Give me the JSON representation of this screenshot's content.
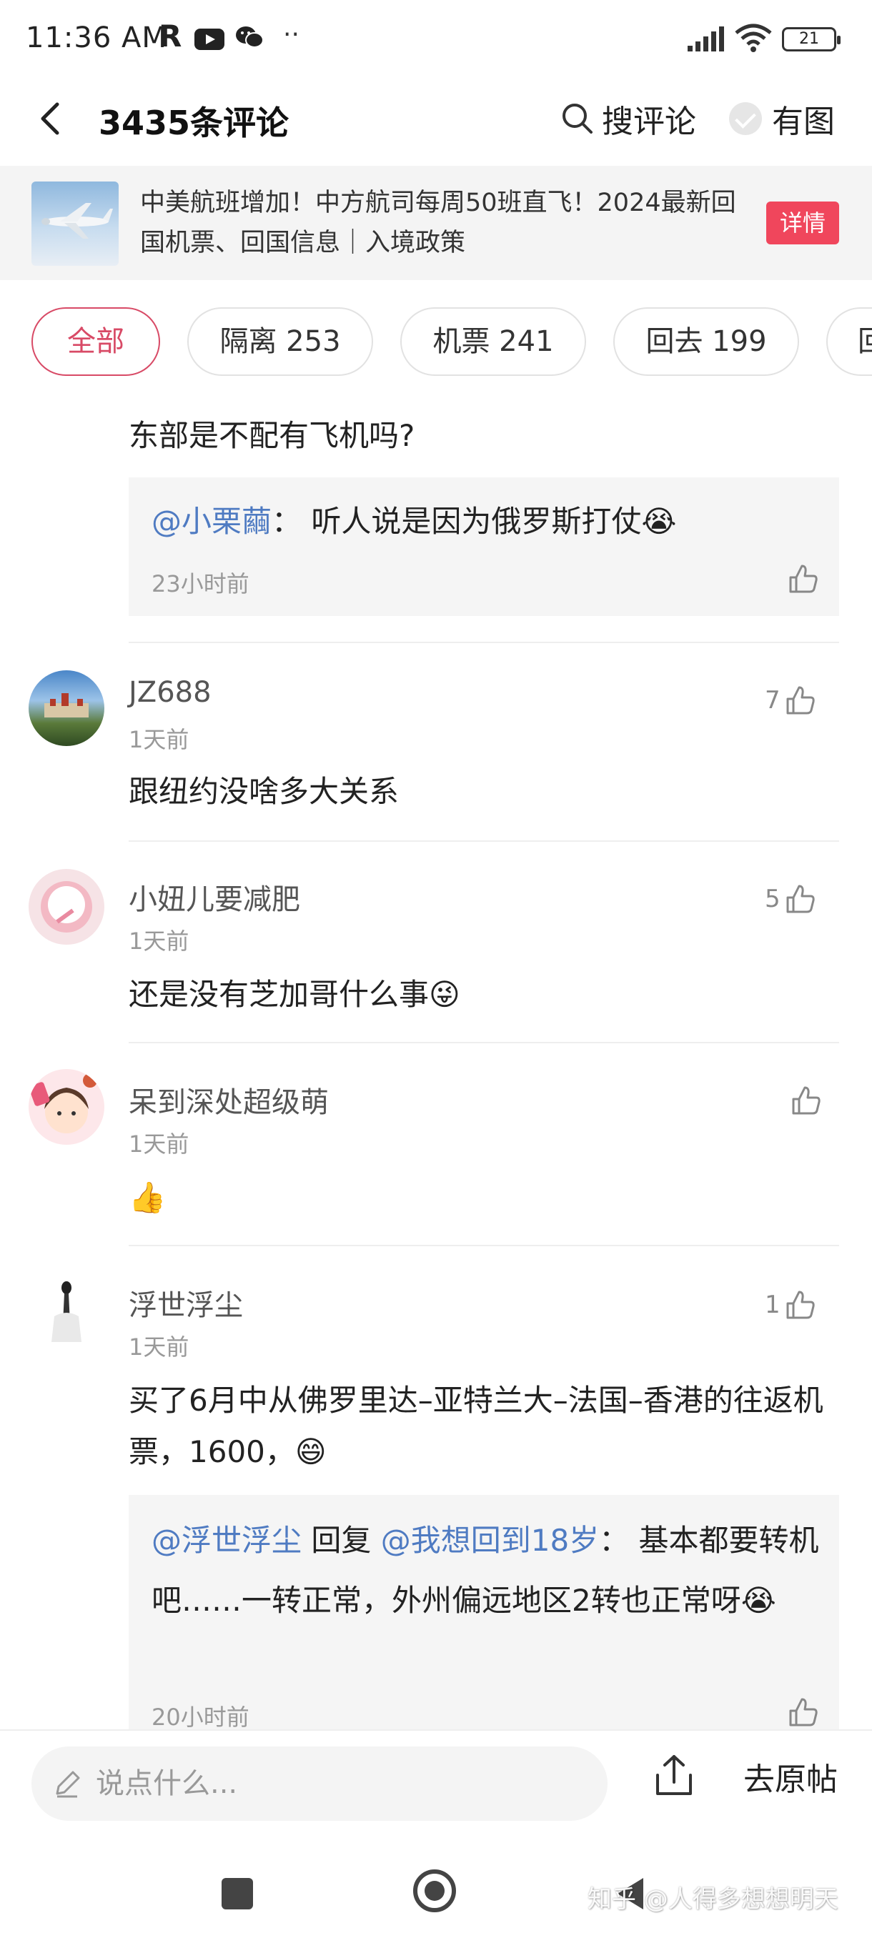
{
  "status_bar": {
    "time": "11:36 AM",
    "r_label": "R",
    "dots": "··",
    "battery": "21"
  },
  "header": {
    "title": "3435条评论",
    "search_label": "搜评论",
    "image_filter_label": "有图"
  },
  "banner": {
    "text": "中美航班增加！中方航司每周50班直飞！2024最新回国机票、回国信息｜入境政策",
    "button_label": "详情"
  },
  "tabs": [
    {
      "label": "全部",
      "active": true
    },
    {
      "label": "隔离 253",
      "active": false
    },
    {
      "label": "机票 241",
      "active": false
    },
    {
      "label": "回去 199",
      "active": false
    },
    {
      "label": "回",
      "active": false
    }
  ],
  "comments": [
    {
      "text": "东部是不配有飞机吗?",
      "reply": {
        "mention": "@小栗繭",
        "separator": "：",
        "text": " 听人说是因为俄罗斯打仗😭",
        "time": "23小时前"
      }
    },
    {
      "name": "JZ688",
      "time": "1天前",
      "likes": "7",
      "text": "跟纽约没啥多大关系"
    },
    {
      "name": "小妞儿要减肥",
      "time": "1天前",
      "likes": "5",
      "text": "还是没有芝加哥什么事😜"
    },
    {
      "name": "呆到深处超级萌",
      "time": "1天前",
      "likes": "",
      "text": "👍"
    },
    {
      "name": "浮世浮尘",
      "time": "1天前",
      "likes": "1",
      "text": "买了6月中从佛罗里达–亚特兰大–法国–香港的往返机票，1600，😄",
      "reply": {
        "mention": "@浮世浮尘",
        "reply_word": " 回复 ",
        "mention2": "@我想回到18岁",
        "separator": "：",
        "text": " 基本都要转机吧……一转正常，外州偏远地区2转也正常呀😭",
        "time": "20小时前"
      }
    }
  ],
  "bottom": {
    "input_placeholder": "说点什么...",
    "goto_label": "去原帖"
  },
  "watermark": "知乎 @人得多想想明天",
  "colors": {
    "accent": "#d84a66",
    "detail_button": "#f0465c",
    "mention": "#4f7bc2"
  }
}
